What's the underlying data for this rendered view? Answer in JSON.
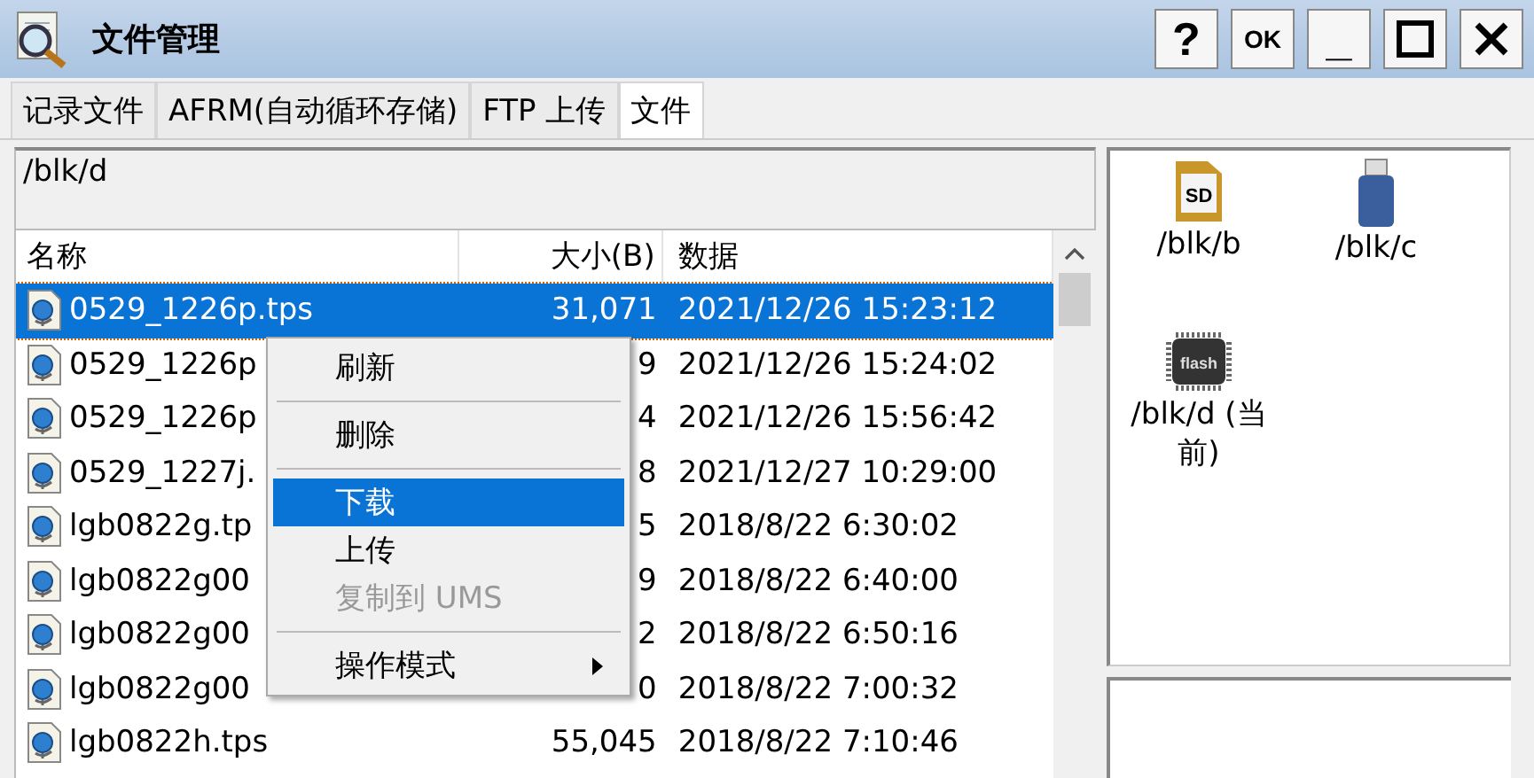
{
  "window": {
    "title": "文件管理",
    "buttons": [
      "?",
      "OK",
      "_"
    ]
  },
  "tabs": [
    {
      "label": "记录文件",
      "selected": false
    },
    {
      "label": "AFRM(自动循环存储)",
      "selected": false
    },
    {
      "label": "FTP 上传",
      "selected": false
    },
    {
      "label": "文件",
      "selected": true
    }
  ],
  "path": "/blk/d",
  "table": {
    "columns": [
      "名称",
      "大小(B)",
      "数据"
    ],
    "rows": [
      {
        "name": "0529_1226p.tps",
        "size": "31,071",
        "date": "2021/12/26 15:23:12",
        "selected": true
      },
      {
        "name": "0529_1226p",
        "size": "9",
        "date": "2021/12/26 15:24:02",
        "selected": false
      },
      {
        "name": "0529_1226p",
        "size": "4",
        "date": "2021/12/26 15:56:42",
        "selected": false
      },
      {
        "name": "0529_1227j.",
        "size": "8",
        "date": "2021/12/27 10:29:00",
        "selected": false
      },
      {
        "name": "lgb0822g.tp",
        "size": "5",
        "date": "2018/8/22 6:30:02",
        "selected": false
      },
      {
        "name": "lgb0822g00",
        "size": "9",
        "date": "2018/8/22 6:40:00",
        "selected": false
      },
      {
        "name": "lgb0822g00",
        "size": "2",
        "date": "2018/8/22 6:50:16",
        "selected": false
      },
      {
        "name": "lgb0822g00",
        "size": "0",
        "date": "2018/8/22 7:00:32",
        "selected": false
      },
      {
        "name": "lgb0822h.tps",
        "size": "55,045",
        "date": "2018/8/22 7:10:46",
        "selected": false
      }
    ]
  },
  "drives": [
    {
      "kind": "sd",
      "icon_label": "SD",
      "label": "/blk/b"
    },
    {
      "kind": "usb",
      "label": "/blk/c"
    },
    {
      "kind": "flash",
      "icon_label": "flash",
      "label": "/blk/d (当前)"
    }
  ],
  "context_menu": [
    {
      "kind": "item",
      "label": "刷新",
      "selected": false,
      "disabled": false
    },
    {
      "kind": "separator"
    },
    {
      "kind": "item",
      "label": "删除",
      "selected": false,
      "disabled": false
    },
    {
      "kind": "separator"
    },
    {
      "kind": "item",
      "label": "下载",
      "selected": true,
      "disabled": false
    },
    {
      "kind": "item",
      "label": "上传",
      "selected": false,
      "disabled": false
    },
    {
      "kind": "item",
      "label": "复制到 UMS",
      "selected": false,
      "disabled": true
    },
    {
      "kind": "separator"
    },
    {
      "kind": "submenu",
      "label": "操作模式",
      "selected": false,
      "disabled": false
    }
  ]
}
